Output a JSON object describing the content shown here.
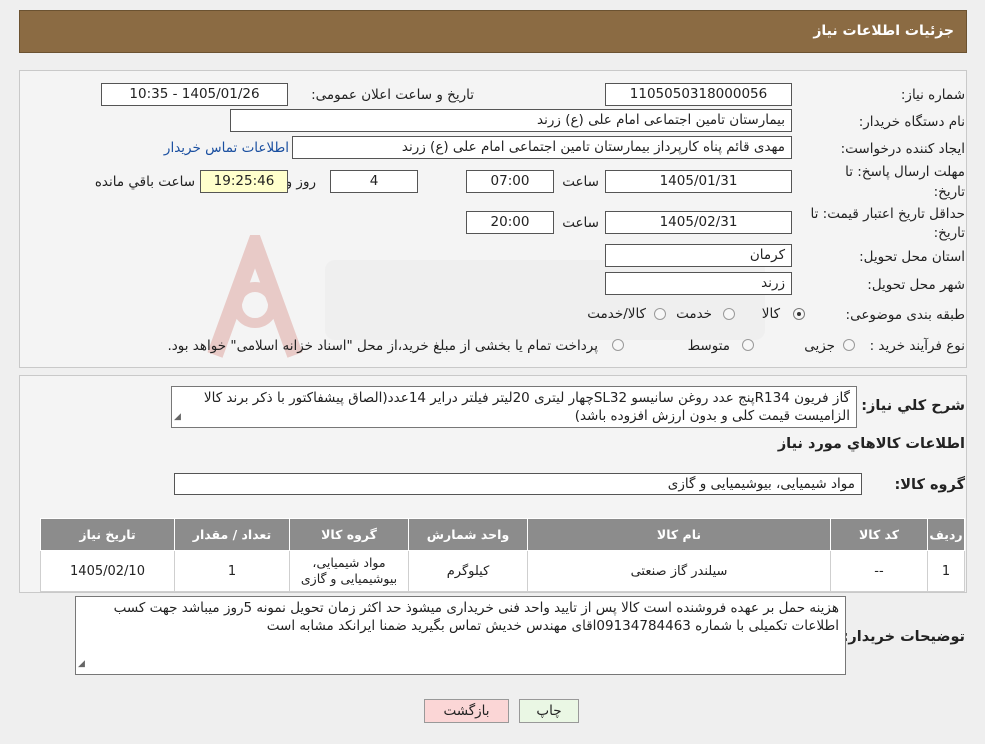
{
  "header": {
    "title": "جزئیات اطلاعات نیاز"
  },
  "form": {
    "need_number_label": "شماره نیاز:",
    "need_number": "1105050318000056",
    "announce_label": "تاریخ و ساعت اعلان عمومی:",
    "announce_value": "1405/01/26 - 10:35",
    "buyer_org_label": "نام دستگاه خریدار:",
    "buyer_org": "بیمارستان تامین اجتماعی امام علی (ع) زرند",
    "creator_label": "ایجاد کننده درخواست:",
    "creator": "مهدی  قائم پناه  کارپرداز بیمارستان تامین اجتماعی امام علی (ع) زرند",
    "contact_link": "اطلاعات تماس خریدار",
    "deadline_label_1": "مهلت ارسال پاسخ: تا",
    "deadline_label_2": "تاریخ:",
    "deadline_date": "1405/01/31",
    "time_label": "ساعت",
    "deadline_time": "07:00",
    "days_value": "4",
    "days_label": "روز و",
    "remaining_time": "19:25:46",
    "remaining_label": "ساعت باقي مانده",
    "validity_label_1": "حداقل تاریخ اعتبار قیمت: تا",
    "validity_label_2": "تاریخ:",
    "validity_date": "1405/02/31",
    "validity_time": "20:00",
    "province_label": "استان محل تحویل:",
    "province": "کرمان",
    "city_label": "شهر محل تحویل:",
    "city": "زرند",
    "category_label": "طبقه بندی موضوعی:",
    "category_options": [
      "کالا",
      "خدمت",
      "کالا/خدمت"
    ],
    "category_selected": "کالا",
    "process_label": "نوع فرآیند خرید :",
    "process_options": [
      "جزیی",
      "متوسط"
    ],
    "process_note": "پرداخت تمام یا بخشی از مبلغ خرید،از محل \"اسناد خزانه اسلامی\" خواهد بود."
  },
  "summary": {
    "label": "شرح کلي نياز:",
    "text": "گاز فریون R134پنج عدد روغن سانیسو SL32چهار لیتری 20لیتر فیلتر درایر 14عدد(الصاق پیشفاکتور با ذکر برند کالا الزامیست قیمت کلی و بدون ارزش افزوده باشد)"
  },
  "goods": {
    "section_title": "اطلاعات کالاهاي مورد نياز",
    "group_label": "گروه کالا:",
    "group_value": "مواد شیمیایی، بیوشیمیایی و  گازی",
    "columns": [
      "رديف",
      "کد کالا",
      "نام کالا",
      "واحد شمارش",
      "گروه کالا",
      "تعداد / مقدار",
      "تاريخ نياز"
    ],
    "rows": [
      {
        "row": "1",
        "code": "--",
        "name": "سیلندر گاز صنعتی",
        "unit": "کیلوگرم",
        "group": "مواد شیمیایی، بیوشیمیایی و گازی",
        "qty": "1",
        "date": "1405/02/10"
      }
    ]
  },
  "buyer_notes": {
    "label": "توضیحات خریدار:",
    "text": "هزینه حمل بر عهده فروشنده است کالا پس از تایید واحد فنی خریداری میشوذ حد اکثر زمان تحویل نمونه 5روز میباشد جهت کسب اطلاعات تکمیلی با شماره 09134784463اقای مهندس خدیش تماس بگیرید ضمنا ایرانکد مشابه است"
  },
  "buttons": {
    "print": "چاپ",
    "back": "بازگشت"
  },
  "colors": {
    "header": "#8b6b43",
    "table_header": "#8c8c8c",
    "link": "#1a4fa0",
    "back_button": "#fbd6d6",
    "print_button": "#eaf7e4"
  }
}
